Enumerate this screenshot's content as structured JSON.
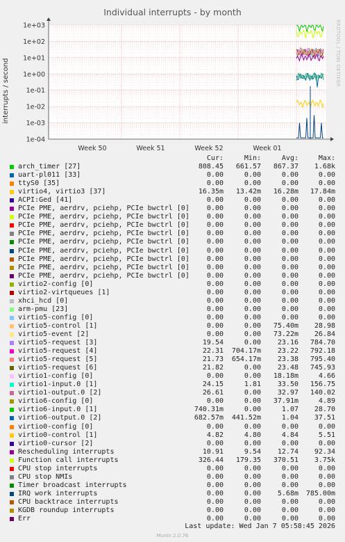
{
  "title": "Individual interrupts - by month",
  "ylabel": "interrupts / second",
  "watermark": "RRDTOOL / TOBI OETIKER",
  "last_update": "Last update: Wed Jan  7 05:58:45 2026",
  "footer": "Munin 2.0.76",
  "headers": {
    "cur": "Cur:",
    "min": "Min:",
    "avg": "Avg:",
    "max": "Max:"
  },
  "chart_data": {
    "type": "line",
    "title": "Individual interrupts - by month",
    "ylabel": "interrupts / second",
    "yscale": "log",
    "ylim": [
      0.0001,
      1000
    ],
    "yticks": [
      "1e-04",
      "1e-03",
      "1e-02",
      "1e-01",
      "1e+00",
      "1e+01",
      "1e+02",
      "1e+03"
    ],
    "xticks": [
      "Week 50",
      "Week 51",
      "Week 52",
      "Week 01"
    ],
    "grid": true,
    "note": "All series only have data in the last days of the range (after Week 01)",
    "series": [
      {
        "name": "arch_timer [27]",
        "color": "#00cc00",
        "level": 808.45
      },
      {
        "name": "Function call interrupts",
        "color": "#ccff00",
        "level": 326.44
      },
      {
        "name": "virtio1-input.0 [1]",
        "color": "#33ffcc",
        "level": 24.15
      },
      {
        "name": "virtio1-output.0 [2]",
        "color": "#cc6699",
        "level": 26.61
      },
      {
        "name": "virtio5-request [3]",
        "color": "#b399ff",
        "level": 19.54
      },
      {
        "name": "virtio5-request [5]",
        "color": "#ff66b3",
        "level": 21.73
      },
      {
        "name": "virtio5-request [6]",
        "color": "#666600",
        "level": 21.82
      },
      {
        "name": "virtio5-request [4]",
        "color": "#ff9999",
        "level": 22.31
      },
      {
        "name": "Rescheduling interrupts",
        "color": "#990099",
        "level": 10.91
      },
      {
        "name": "virtio6-output.0 [2]",
        "color": "#006699",
        "level": 0.68257
      },
      {
        "name": "virtio6-input.0 [1]",
        "color": "#00aa66",
        "level": 0.74031
      },
      {
        "name": "virtio4, virtio3 [37]",
        "color": "#ffcc00",
        "level": 0.01635
      },
      {
        "name": "IRQ work interrupts",
        "color": "#004080",
        "level": 0.0001
      }
    ]
  },
  "rows": [
    {
      "name": "arch_timer [27]",
      "color": "#00cc00",
      "cur": "808.45",
      "min": "661.57",
      "avg": "867.37",
      "max": "1.68k"
    },
    {
      "name": "uart-pl011 [33]",
      "color": "#0066b3",
      "cur": "0.00",
      "min": "0.00",
      "avg": "0.00",
      "max": "0.00"
    },
    {
      "name": "ttyS0 [35]",
      "color": "#ff8000",
      "cur": "0.00",
      "min": "0.00",
      "avg": "0.00",
      "max": "0.00"
    },
    {
      "name": "virtio4, virtio3 [37]",
      "color": "#ffcc00",
      "cur": "16.35m",
      "min": "13.42m",
      "avg": "16.28m",
      "max": "17.84m"
    },
    {
      "name": "ACPI:Ged [41]",
      "color": "#330099",
      "cur": "0.00",
      "min": "0.00",
      "avg": "0.00",
      "max": "0.00"
    },
    {
      "name": "PCIe PME, aerdrv, pciehp, PCIe bwctrl [0]",
      "color": "#990099",
      "cur": "0.00",
      "min": "0.00",
      "avg": "0.00",
      "max": "0.00"
    },
    {
      "name": "PCIe PME, aerdrv, pciehp, PCIe bwctrl [0]",
      "color": "#ccff00",
      "cur": "0.00",
      "min": "0.00",
      "avg": "0.00",
      "max": "0.00"
    },
    {
      "name": "PCIe PME, aerdrv, pciehp, PCIe bwctrl [0]",
      "color": "#ff0000",
      "cur": "0.00",
      "min": "0.00",
      "avg": "0.00",
      "max": "0.00"
    },
    {
      "name": "PCIe PME, aerdrv, pciehp, PCIe bwctrl [0]",
      "color": "#808080",
      "cur": "0.00",
      "min": "0.00",
      "avg": "0.00",
      "max": "0.00"
    },
    {
      "name": "PCIe PME, aerdrv, pciehp, PCIe bwctrl [0]",
      "color": "#008f00",
      "cur": "0.00",
      "min": "0.00",
      "avg": "0.00",
      "max": "0.00"
    },
    {
      "name": "PCIe PME, aerdrv, pciehp, PCIe bwctrl [0]",
      "color": "#00487d",
      "cur": "0.00",
      "min": "0.00",
      "avg": "0.00",
      "max": "0.00"
    },
    {
      "name": "PCIe PME, aerdrv, pciehp, PCIe bwctrl [0]",
      "color": "#b35a00",
      "cur": "0.00",
      "min": "0.00",
      "avg": "0.00",
      "max": "0.00"
    },
    {
      "name": "PCIe PME, aerdrv, pciehp, PCIe bwctrl [0]",
      "color": "#b38f00",
      "cur": "0.00",
      "min": "0.00",
      "avg": "0.00",
      "max": "0.00"
    },
    {
      "name": "PCIe PME, aerdrv, pciehp, PCIe bwctrl [0]",
      "color": "#6b006b",
      "cur": "0.00",
      "min": "0.00",
      "avg": "0.00",
      "max": "0.00"
    },
    {
      "name": "virtio2-config [0]",
      "color": "#8fb300",
      "cur": "0.00",
      "min": "0.00",
      "avg": "0.00",
      "max": "0.00"
    },
    {
      "name": "virtio2-virtqueues [1]",
      "color": "#b30000",
      "cur": "0.00",
      "min": "0.00",
      "avg": "0.00",
      "max": "0.00"
    },
    {
      "name": "xhci_hcd [0]",
      "color": "#bebebe",
      "cur": "0.00",
      "min": "0.00",
      "avg": "0.00",
      "max": "0.00"
    },
    {
      "name": "arm-pmu [23]",
      "color": "#80ff80",
      "cur": "0.00",
      "min": "0.00",
      "avg": "0.00",
      "max": "0.00"
    },
    {
      "name": "virtio5-config [0]",
      "color": "#80c9ff",
      "cur": "0.00",
      "min": "0.00",
      "avg": "0.00",
      "max": "0.00"
    },
    {
      "name": "virtio5-control [1]",
      "color": "#ffc080",
      "cur": "0.00",
      "min": "0.00",
      "avg": "75.40m",
      "max": "28.98"
    },
    {
      "name": "virtio5-event [2]",
      "color": "#ffe680",
      "cur": "0.00",
      "min": "0.00",
      "avg": "73.22m",
      "max": "26.84"
    },
    {
      "name": "virtio5-request [3]",
      "color": "#aa80ff",
      "cur": "19.54",
      "min": "0.00",
      "avg": "23.16",
      "max": "784.70"
    },
    {
      "name": "virtio5-request [4]",
      "color": "#ee00cc",
      "cur": "22.31",
      "min": "704.17m",
      "avg": "23.22",
      "max": "792.18"
    },
    {
      "name": "virtio5-request [5]",
      "color": "#ff8080",
      "cur": "21.73",
      "min": "654.17m",
      "avg": "23.38",
      "max": "795.40"
    },
    {
      "name": "virtio5-request [6]",
      "color": "#666600",
      "cur": "21.82",
      "min": "0.00",
      "avg": "23.48",
      "max": "745.93"
    },
    {
      "name": "virtio1-config [0]",
      "color": "#ffbfff",
      "cur": "0.00",
      "min": "0.00",
      "avg": "18.18m",
      "max": "4.66"
    },
    {
      "name": "virtio1-input.0 [1]",
      "color": "#00ffcc",
      "cur": "24.15",
      "min": "1.81",
      "avg": "33.50",
      "max": "156.75"
    },
    {
      "name": "virtio1-output.0 [2]",
      "color": "#cc6699",
      "cur": "26.61",
      "min": "0.00",
      "avg": "32.97",
      "max": "140.02"
    },
    {
      "name": "virtio6-config [0]",
      "color": "#999900",
      "cur": "0.00",
      "min": "0.00",
      "avg": "37.91m",
      "max": "4.89"
    },
    {
      "name": "virtio6-input.0 [1]",
      "color": "#00cc00",
      "cur": "740.31m",
      "min": "0.00",
      "avg": "1.07",
      "max": "28.70"
    },
    {
      "name": "virtio6-output.0 [2]",
      "color": "#0066b3",
      "cur": "682.57m",
      "min": "441.52m",
      "avg": "1.04",
      "max": "37.51"
    },
    {
      "name": "virtio0-config [0]",
      "color": "#ff8000",
      "cur": "0.00",
      "min": "0.00",
      "avg": "0.00",
      "max": "0.00"
    },
    {
      "name": "virtio0-control [1]",
      "color": "#ffcc00",
      "cur": "4.82",
      "min": "4.80",
      "avg": "4.84",
      "max": "5.51"
    },
    {
      "name": "virtio0-cursor [2]",
      "color": "#330099",
      "cur": "0.00",
      "min": "0.00",
      "avg": "0.00",
      "max": "0.00"
    },
    {
      "name": "Rescheduling interrupts",
      "color": "#990099",
      "cur": "10.91",
      "min": "9.54",
      "avg": "12.74",
      "max": "92.34"
    },
    {
      "name": "Function call interrupts",
      "color": "#ccff00",
      "cur": "326.44",
      "min": "179.35",
      "avg": "370.51",
      "max": "3.75k"
    },
    {
      "name": "CPU stop interrupts",
      "color": "#ff0000",
      "cur": "0.00",
      "min": "0.00",
      "avg": "0.00",
      "max": "0.00"
    },
    {
      "name": "CPU stop NMIs",
      "color": "#808080",
      "cur": "0.00",
      "min": "0.00",
      "avg": "0.00",
      "max": "0.00"
    },
    {
      "name": "Timer broadcast interrupts",
      "color": "#008f00",
      "cur": "0.00",
      "min": "0.00",
      "avg": "0.00",
      "max": "0.00"
    },
    {
      "name": "IRQ work interrupts",
      "color": "#00487d",
      "cur": "0.00",
      "min": "0.00",
      "avg": "5.68m",
      "max": "785.00m"
    },
    {
      "name": "CPU backtrace interrupts",
      "color": "#b35a00",
      "cur": "0.00",
      "min": "0.00",
      "avg": "0.00",
      "max": "0.00"
    },
    {
      "name": "KGDB roundup interrupts",
      "color": "#b38f00",
      "cur": "0.00",
      "min": "0.00",
      "avg": "0.00",
      "max": "0.00"
    },
    {
      "name": "Err",
      "color": "#6b006b",
      "cur": "0.00",
      "min": "0.00",
      "avg": "0.00",
      "max": "0.00"
    }
  ]
}
